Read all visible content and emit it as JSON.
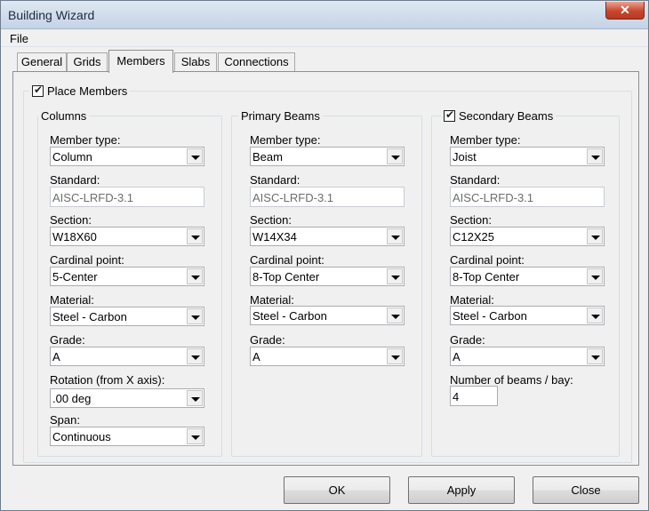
{
  "window": {
    "title": "Building Wizard",
    "close_glyph": "✕"
  },
  "menu": {
    "file": "File"
  },
  "tabs": [
    "General",
    "Grids",
    "Members",
    "Slabs",
    "Connections"
  ],
  "place_members": {
    "label": "Place Members",
    "checked": true
  },
  "columns": {
    "title": "Columns",
    "member_type_label": "Member type:",
    "member_type": "Column",
    "standard_label": "Standard:",
    "standard": "AISC-LRFD-3.1",
    "section_label": "Section:",
    "section": "W18X60",
    "cardinal_label": "Cardinal point:",
    "cardinal": "5-Center",
    "material_label": "Material:",
    "material": "Steel - Carbon",
    "grade_label": "Grade:",
    "grade": "A",
    "rotation_label": "Rotation (from X axis):",
    "rotation": ".00 deg",
    "span_label": "Span:",
    "span": "Continuous"
  },
  "primary": {
    "title": "Primary Beams",
    "member_type_label": "Member type:",
    "member_type": "Beam",
    "standard_label": "Standard:",
    "standard": "AISC-LRFD-3.1",
    "section_label": "Section:",
    "section": "W14X34",
    "cardinal_label": "Cardinal point:",
    "cardinal": "8-Top Center",
    "material_label": "Material:",
    "material": "Steel - Carbon",
    "grade_label": "Grade:",
    "grade": "A"
  },
  "secondary": {
    "title": "Secondary Beams",
    "checked": true,
    "member_type_label": "Member type:",
    "member_type": "Joist",
    "standard_label": "Standard:",
    "standard": "AISC-LRFD-3.1",
    "section_label": "Section:",
    "section": "C12X25",
    "cardinal_label": "Cardinal point:",
    "cardinal": "8-Top Center",
    "material_label": "Material:",
    "material": "Steel - Carbon",
    "grade_label": "Grade:",
    "grade": "A",
    "beams_per_bay_label": "Number of beams / bay:",
    "beams_per_bay": "4"
  },
  "buttons": {
    "ok": "OK",
    "apply": "Apply",
    "close": "Close"
  }
}
